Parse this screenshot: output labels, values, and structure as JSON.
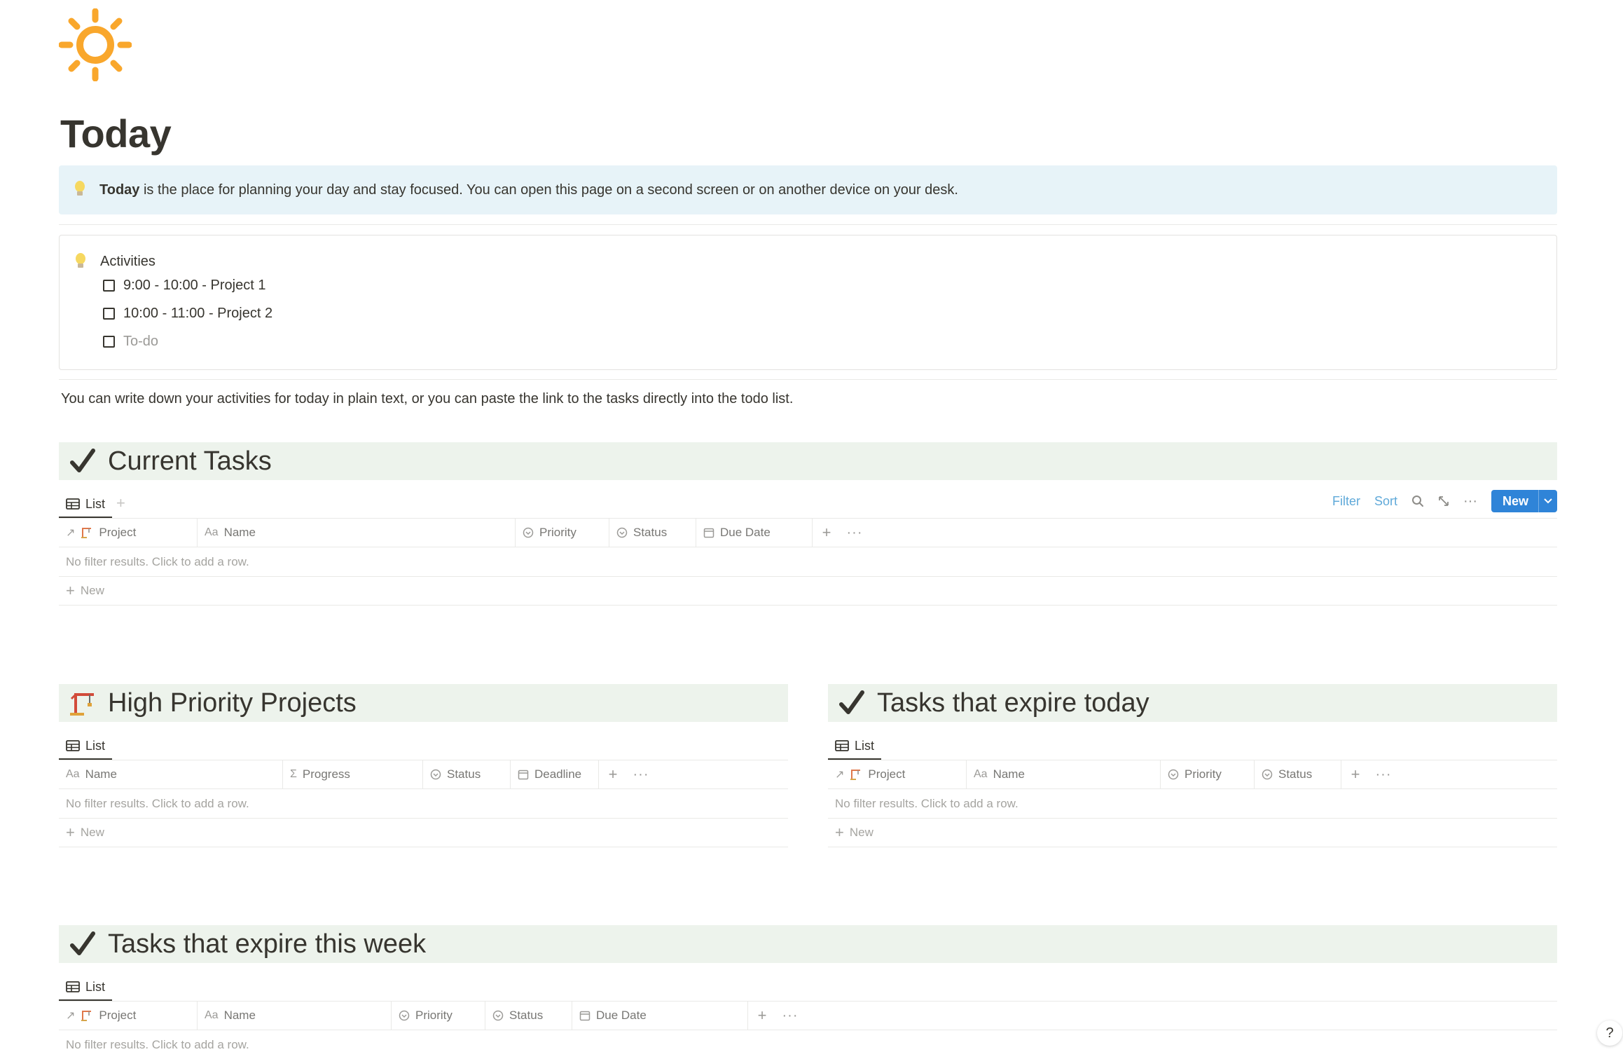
{
  "page": {
    "icon": "sun-icon",
    "title": "Today"
  },
  "info_callout": {
    "icon": "lightbulb-icon",
    "bold": "Today",
    "text": " is the place for planning your day and stay focused. You can open this page on a second screen or on another device on your desk."
  },
  "activities": {
    "icon": "lightbulb-icon",
    "title": "Activities",
    "items": [
      {
        "label": "9:00 - 10:00 - Project 1",
        "checked": false
      },
      {
        "label": "10:00 - 11:00 - Project 2",
        "checked": false
      },
      {
        "label": "To-do",
        "checked": false,
        "placeholder": true
      }
    ]
  },
  "note": "You can write down your activities for today in plain text, or you can paste the link to the tasks directly into the todo list.",
  "current_tasks": {
    "icon": "checkmark-icon",
    "title": "Current Tasks",
    "view_tab": "List",
    "toolbar": {
      "filter": "Filter",
      "sort": "Sort",
      "new": "New"
    },
    "columns": [
      "Project",
      "Name",
      "Priority",
      "Status",
      "Due Date"
    ],
    "empty": "No filter results. Click to add a row.",
    "new_row": "New"
  },
  "high_priority": {
    "icon": "crane-icon",
    "title": "High Priority Projects",
    "view_tab": "List",
    "columns": [
      "Name",
      "Progress",
      "Status",
      "Deadline"
    ],
    "empty": "No filter results. Click to add a row.",
    "new_row": "New"
  },
  "expire_today": {
    "icon": "checkmark-icon",
    "title": "Tasks that expire today",
    "view_tab": "List",
    "columns": [
      "Project",
      "Name",
      "Priority",
      "Status"
    ],
    "empty": "No filter results. Click to add a row.",
    "new_row": "New"
  },
  "expire_week": {
    "icon": "checkmark-icon",
    "title": "Tasks that expire this week",
    "view_tab": "List",
    "columns": [
      "Project",
      "Name",
      "Priority",
      "Status",
      "Due Date"
    ],
    "empty": "No filter results. Click to add a row."
  },
  "help": {
    "label": "?"
  },
  "colors": {
    "accent": "#2f84d8",
    "callout_bg": "#e7f3f8",
    "section_bg": "#edf3ec",
    "sun": "#f9a72c"
  }
}
